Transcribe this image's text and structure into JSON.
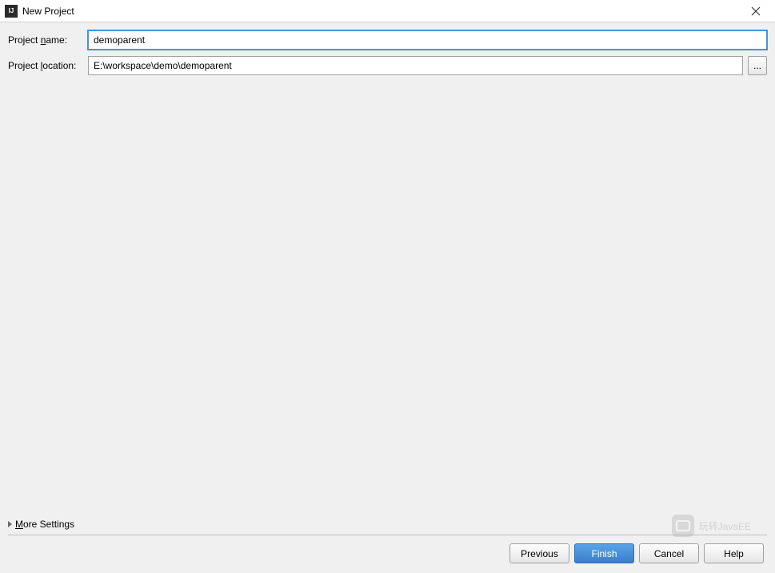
{
  "titlebar": {
    "title": "New Project"
  },
  "form": {
    "project_name_label_pre": "Project ",
    "project_name_label_u": "n",
    "project_name_label_post": "ame:",
    "project_name_value": "demoparent",
    "project_location_label_pre": "Project ",
    "project_location_label_u": "l",
    "project_location_label_post": "ocation:",
    "project_location_value": "E:\\workspace\\demo\\demoparent",
    "browse_label": "..."
  },
  "more_settings": {
    "label_u": "M",
    "label_post": "ore Settings"
  },
  "buttons": {
    "previous": "Previous",
    "finish": "Finish",
    "cancel": "Cancel",
    "help": "Help"
  },
  "watermark": {
    "text": "玩转JavaEE"
  }
}
